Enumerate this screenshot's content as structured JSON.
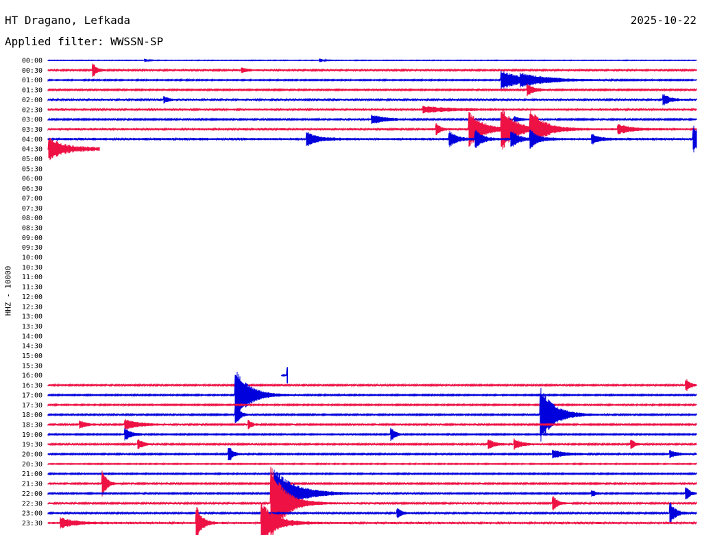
{
  "header": {
    "station": "HT Dragano, Lefkada",
    "date": "2025-10-22",
    "filter": "Applied filter: WWSSN-SP"
  },
  "chart_data": {
    "type": "line",
    "title": "HT Dragano, Lefkada",
    "ylabel": "HHZ - 10000",
    "colors": [
      "#0000dd",
      "#ee1144"
    ],
    "rows": [
      "00:00",
      "00:30",
      "01:00",
      "01:30",
      "02:00",
      "02:30",
      "03:00",
      "03:30",
      "04:00",
      "04:30",
      "05:00",
      "05:30",
      "06:00",
      "06:30",
      "07:00",
      "07:30",
      "08:00",
      "08:30",
      "09:00",
      "09:30",
      "10:00",
      "10:30",
      "11:00",
      "11:30",
      "12:00",
      "12:30",
      "13:00",
      "13:30",
      "14:00",
      "14:30",
      "15:00",
      "15:30",
      "16:00",
      "16:30",
      "17:00",
      "17:30",
      "18:00",
      "18:30",
      "19:00",
      "19:30",
      "20:00",
      "20:30",
      "21:00",
      "21:30",
      "22:00",
      "22:30",
      "23:00",
      "23:30"
    ],
    "coverage": [
      1,
      1,
      1,
      1,
      1,
      1,
      1,
      1,
      1,
      0.08,
      0,
      0,
      0,
      0,
      0,
      0,
      0,
      0,
      0,
      0,
      0,
      0,
      0,
      0,
      0,
      0,
      0,
      0,
      0,
      0,
      0,
      0,
      0.37,
      1,
      1,
      1,
      1,
      1,
      1,
      1,
      1,
      1,
      1,
      1,
      1,
      1,
      1,
      1
    ],
    "coverage_start": [
      0,
      0,
      0,
      0,
      0,
      0,
      0,
      0,
      0,
      0,
      0,
      0,
      0,
      0,
      0,
      0,
      0,
      0,
      0,
      0,
      0,
      0,
      0,
      0,
      0,
      0,
      0,
      0,
      0,
      0,
      0,
      0,
      0.36,
      0,
      0,
      0,
      0,
      0,
      0,
      0,
      0,
      0,
      0,
      0,
      0,
      0,
      0,
      0
    ],
    "noise": [
      0.4,
      1.2,
      0.8,
      1.0,
      1.2,
      1.4,
      1.0,
      1.4,
      1.6,
      2.5,
      0,
      0,
      0,
      0,
      0,
      0,
      0,
      0,
      0,
      0,
      0,
      0,
      0,
      0,
      0,
      0,
      0,
      0,
      0,
      0,
      0,
      0,
      0.8,
      1.0,
      0.9,
      0.9,
      1.0,
      1.0,
      0.9,
      1.0,
      1.0,
      0.7,
      0.9,
      1.0,
      1.0,
      1.1,
      1.2,
      1.4
    ],
    "events": [
      {
        "row": 0,
        "x": 0.42,
        "amp": 2.5,
        "dur": 0.005
      },
      {
        "row": 0,
        "x": 0.15,
        "amp": 2.0,
        "dur": 0.004
      },
      {
        "row": 1,
        "x": 0.07,
        "amp": 9,
        "dur": 0.005
      },
      {
        "row": 1,
        "x": 0.3,
        "amp": 3,
        "dur": 0.008
      },
      {
        "row": 2,
        "x": 0.7,
        "amp": 13,
        "dur": 0.03
      },
      {
        "row": 2,
        "x": 0.73,
        "amp": 5,
        "dur": 0.05
      },
      {
        "row": 3,
        "x": 0.74,
        "amp": 8,
        "dur": 0.01
      },
      {
        "row": 4,
        "x": 0.95,
        "amp": 7,
        "dur": 0.01
      },
      {
        "row": 4,
        "x": 0.18,
        "amp": 4,
        "dur": 0.006
      },
      {
        "row": 5,
        "x": 0.58,
        "amp": 4,
        "dur": 0.04
      },
      {
        "row": 6,
        "x": 0.5,
        "amp": 6,
        "dur": 0.02
      },
      {
        "row": 6,
        "x": 0.72,
        "amp": 4,
        "dur": 0.008
      },
      {
        "row": 7,
        "x": 0.65,
        "amp": 24,
        "dur": 0.02
      },
      {
        "row": 7,
        "x": 0.7,
        "amp": 28,
        "dur": 0.02
      },
      {
        "row": 7,
        "x": 0.745,
        "amp": 24,
        "dur": 0.02
      },
      {
        "row": 7,
        "x": 0.88,
        "amp": 6,
        "dur": 0.02
      },
      {
        "row": 7,
        "x": 0.6,
        "amp": 7,
        "dur": 0.006
      },
      {
        "row": 8,
        "x": 0.4,
        "amp": 9,
        "dur": 0.015
      },
      {
        "row": 8,
        "x": 0.62,
        "amp": 10,
        "dur": 0.01
      },
      {
        "row": 8,
        "x": 0.66,
        "amp": 12,
        "dur": 0.01
      },
      {
        "row": 8,
        "x": 0.715,
        "amp": 12,
        "dur": 0.01
      },
      {
        "row": 8,
        "x": 0.745,
        "amp": 12,
        "dur": 0.01
      },
      {
        "row": 8,
        "x": 0.84,
        "amp": 7,
        "dur": 0.01
      },
      {
        "row": 8,
        "x": 0.996,
        "amp": 18,
        "dur": 0.01
      },
      {
        "row": 9,
        "x": 0.003,
        "amp": 14,
        "dur": 0.02
      },
      {
        "row": 33,
        "x": 0.985,
        "amp": 8,
        "dur": 0.006
      },
      {
        "row": 34,
        "x": 0.29,
        "amp": 36,
        "dur": 0.02
      },
      {
        "row": 32,
        "x": 0.37,
        "amp": 14,
        "dur": 0.04
      },
      {
        "row": 36,
        "x": 0.76,
        "amp": 38,
        "dur": 0.02
      },
      {
        "row": 36,
        "x": 0.29,
        "amp": 14,
        "dur": 0.006
      },
      {
        "row": 37,
        "x": 0.05,
        "amp": 5,
        "dur": 0.01
      },
      {
        "row": 37,
        "x": 0.12,
        "amp": 7,
        "dur": 0.02
      },
      {
        "row": 37,
        "x": 0.31,
        "amp": 6,
        "dur": 0.005
      },
      {
        "row": 38,
        "x": 0.12,
        "amp": 8,
        "dur": 0.01
      },
      {
        "row": 38,
        "x": 0.53,
        "amp": 9,
        "dur": 0.006
      },
      {
        "row": 39,
        "x": 0.14,
        "amp": 6,
        "dur": 0.008
      },
      {
        "row": 39,
        "x": 0.68,
        "amp": 6,
        "dur": 0.01
      },
      {
        "row": 39,
        "x": 0.72,
        "amp": 7,
        "dur": 0.01
      },
      {
        "row": 39,
        "x": 0.9,
        "amp": 7,
        "dur": 0.005
      },
      {
        "row": 40,
        "x": 0.28,
        "amp": 10,
        "dur": 0.006
      },
      {
        "row": 40,
        "x": 0.78,
        "amp": 5,
        "dur": 0.02
      },
      {
        "row": 40,
        "x": 0.96,
        "amp": 5,
        "dur": 0.01
      },
      {
        "row": 43,
        "x": 0.085,
        "amp": 18,
        "dur": 0.006
      },
      {
        "row": 44,
        "x": 0.35,
        "amp": 34,
        "dur": 0.03
      },
      {
        "row": 44,
        "x": 0.84,
        "amp": 4,
        "dur": 0.005
      },
      {
        "row": 44,
        "x": 0.985,
        "amp": 8,
        "dur": 0.006
      },
      {
        "row": 45,
        "x": 0.78,
        "amp": 10,
        "dur": 0.006
      },
      {
        "row": 45,
        "x": 0.345,
        "amp": 52,
        "dur": 0.02
      },
      {
        "row": 46,
        "x": 0.54,
        "amp": 6,
        "dur": 0.006
      },
      {
        "row": 46,
        "x": 0.96,
        "amp": 14,
        "dur": 0.008
      },
      {
        "row": 47,
        "x": 0.23,
        "amp": 22,
        "dur": 0.008
      },
      {
        "row": 47,
        "x": 0.33,
        "amp": 28,
        "dur": 0.02
      },
      {
        "row": 47,
        "x": 0.02,
        "amp": 7,
        "dur": 0.02
      }
    ]
  }
}
